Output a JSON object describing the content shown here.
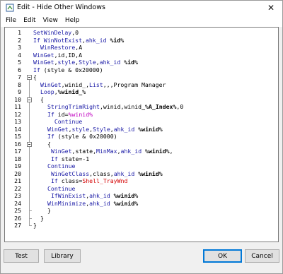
{
  "window": {
    "title": "Edit - Hide Other Windows",
    "close_glyph": "✕"
  },
  "menu": [
    "File",
    "Edit",
    "View",
    "Help"
  ],
  "editor": {
    "lines": [
      {
        "n": "1",
        "indent": 0,
        "tokens": [
          [
            "cmd",
            "SetWinDelay"
          ],
          [
            "txt",
            ",0"
          ]
        ]
      },
      {
        "n": "2",
        "indent": 0,
        "tokens": [
          [
            "cmd",
            "If WinNotExist"
          ],
          [
            "txt",
            ","
          ],
          [
            "cmd",
            "ahk_id"
          ],
          [
            "bold",
            " %id%"
          ]
        ]
      },
      {
        "n": "3",
        "indent": 1,
        "tokens": [
          [
            "cmd",
            "WinRestore"
          ],
          [
            "txt",
            ",A"
          ]
        ]
      },
      {
        "n": "4",
        "indent": 0,
        "tokens": [
          [
            "cmd",
            "WinGet"
          ],
          [
            "txt",
            ",id,ID,A"
          ]
        ]
      },
      {
        "n": "5",
        "indent": 0,
        "tokens": [
          [
            "cmd",
            "WinGet"
          ],
          [
            "txt",
            ","
          ],
          [
            "cmd",
            "style"
          ],
          [
            "txt",
            ","
          ],
          [
            "cmd",
            "Style"
          ],
          [
            "txt",
            ","
          ],
          [
            "cmd",
            "ahk_id"
          ],
          [
            "bold",
            " %id%"
          ]
        ]
      },
      {
        "n": "6",
        "indent": 0,
        "tokens": [
          [
            "cmd",
            "If"
          ],
          [
            "txt",
            " (style & 0x20000)"
          ]
        ]
      },
      {
        "n": "7",
        "indent": 0,
        "tokens": [
          [
            "txt",
            "{"
          ]
        ]
      },
      {
        "n": "8",
        "indent": 1,
        "tokens": [
          [
            "cmd",
            "WinGet"
          ],
          [
            "txt",
            ",winid_,"
          ],
          [
            "cmd",
            "List"
          ],
          [
            "txt",
            ",,,Program Manager"
          ]
        ]
      },
      {
        "n": "9",
        "indent": 1,
        "tokens": [
          [
            "cmd",
            "Loop"
          ],
          [
            "txt",
            ","
          ],
          [
            "bold",
            "%winid_%"
          ]
        ]
      },
      {
        "n": "10",
        "indent": 1,
        "tokens": [
          [
            "txt",
            "{"
          ]
        ]
      },
      {
        "n": "11",
        "indent": 2,
        "tokens": [
          [
            "cmd",
            "StringTrimRight"
          ],
          [
            "txt",
            ",winid,winid"
          ],
          [
            "bold",
            "_%A_Index%"
          ],
          [
            "txt",
            ",0"
          ]
        ]
      },
      {
        "n": "12",
        "indent": 2,
        "tokens": [
          [
            "cmd",
            "If"
          ],
          [
            "txt",
            " id="
          ],
          [
            "var",
            "%winid%"
          ]
        ]
      },
      {
        "n": "13",
        "indent": 2,
        "tokens": [
          [
            "txt",
            "  "
          ],
          [
            "cmd",
            "Continue"
          ]
        ]
      },
      {
        "n": "14",
        "indent": 2,
        "tokens": [
          [
            "cmd",
            "WinGet"
          ],
          [
            "txt",
            ","
          ],
          [
            "cmd",
            "style"
          ],
          [
            "txt",
            ","
          ],
          [
            "cmd",
            "Style"
          ],
          [
            "txt",
            ","
          ],
          [
            "cmd",
            "ahk_id"
          ],
          [
            "bold",
            " %winid%"
          ]
        ]
      },
      {
        "n": "15",
        "indent": 2,
        "tokens": [
          [
            "cmd",
            "If"
          ],
          [
            "txt",
            " (style & 0x20000)"
          ]
        ]
      },
      {
        "n": "16",
        "indent": 2,
        "tokens": [
          [
            "txt",
            "{"
          ]
        ]
      },
      {
        "n": "17",
        "indent": 2,
        "tokens": [
          [
            "txt",
            " "
          ],
          [
            "cmd",
            "WinGet"
          ],
          [
            "txt",
            ",state,"
          ],
          [
            "cmd",
            "MinMax"
          ],
          [
            "txt",
            ","
          ],
          [
            "cmd",
            "ahk_id"
          ],
          [
            "bold",
            " %winid%"
          ],
          [
            "txt",
            ","
          ]
        ]
      },
      {
        "n": "18",
        "indent": 2,
        "tokens": [
          [
            "txt",
            " "
          ],
          [
            "cmd",
            "If"
          ],
          [
            "txt",
            " state=-1"
          ]
        ]
      },
      {
        "n": "19",
        "indent": 2,
        "tokens": [
          [
            "cmd",
            "Continue"
          ]
        ]
      },
      {
        "n": "20",
        "indent": 2,
        "tokens": [
          [
            "txt",
            " "
          ],
          [
            "cmd",
            "WinGetClass"
          ],
          [
            "txt",
            ",class,"
          ],
          [
            "cmd",
            "ahk_id"
          ],
          [
            "bold",
            " %winid%"
          ]
        ]
      },
      {
        "n": "21",
        "indent": 2,
        "tokens": [
          [
            "txt",
            " "
          ],
          [
            "cmd",
            "If"
          ],
          [
            "txt",
            " class="
          ],
          [
            "num",
            "Shell_TrayWnd"
          ]
        ]
      },
      {
        "n": "22",
        "indent": 2,
        "tokens": [
          [
            "cmd",
            "Continue"
          ]
        ]
      },
      {
        "n": "23",
        "indent": 2,
        "tokens": [
          [
            "txt",
            " "
          ],
          [
            "cmd",
            "IfWinExist"
          ],
          [
            "txt",
            ","
          ],
          [
            "cmd",
            "ahk_id"
          ],
          [
            "bold",
            " %winid%"
          ]
        ]
      },
      {
        "n": "24",
        "indent": 2,
        "tokens": [
          [
            "cmd",
            "WinMinimize"
          ],
          [
            "txt",
            ","
          ],
          [
            "cmd",
            "ahk_id"
          ],
          [
            "bold",
            " %winid%"
          ]
        ]
      },
      {
        "n": "25",
        "indent": 2,
        "tokens": [
          [
            "txt",
            "}"
          ]
        ]
      },
      {
        "n": "26",
        "indent": 1,
        "tokens": [
          [
            "txt",
            "}"
          ]
        ]
      },
      {
        "n": "27",
        "indent": 0,
        "tokens": [
          [
            "txt",
            "}"
          ]
        ]
      }
    ]
  },
  "buttons": {
    "test": "Test",
    "library": "Library",
    "ok": "OK",
    "cancel": "Cancel"
  },
  "colors": {
    "keyword": "#1a1aa6",
    "variable": "#c000c0",
    "string": "#d40000",
    "accent": "#0078d7"
  }
}
